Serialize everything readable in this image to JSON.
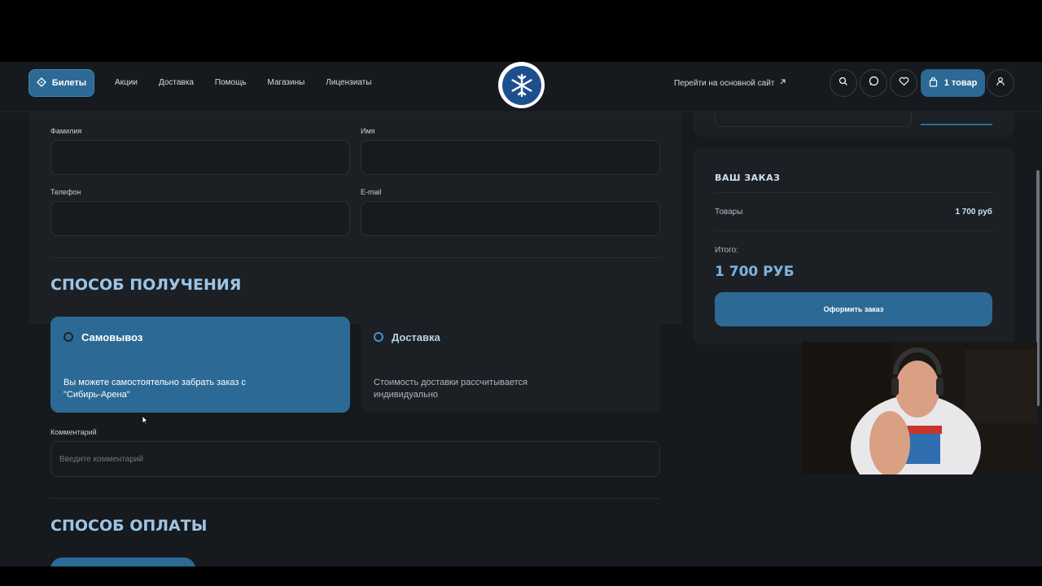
{
  "header": {
    "tickets_label": "Билеты",
    "nav": [
      "Акции",
      "Доставка",
      "Помощь",
      "Магазины",
      "Лицензиаты"
    ],
    "main_site_label": "Перейти на основной сайт",
    "cart_label": "1 товар",
    "logo_icon": "snowflake-logo"
  },
  "form": {
    "surname_label": "Фамилия",
    "name_label": "Имя",
    "phone_label": "Телефон",
    "email_label": "E-mail",
    "delivery_section_title": "СПОСОБ ПОЛУЧЕНИЯ",
    "options": [
      {
        "title": "Самовывоз",
        "desc": "Вы можете самостоятельно забрать заказ с \"Сибирь-Арена\"",
        "selected": true
      },
      {
        "title": "Доставка",
        "desc": "Стоимость доставки рассчитывается индивидуально",
        "selected": false
      }
    ],
    "comment_label": "Комментарий",
    "comment_placeholder": "Введите комментарий",
    "payment_section_title": "СПОСОБ ОПЛАТЫ"
  },
  "order": {
    "title": "ВАШ ЗАКАЗ",
    "goods_label": "Товары",
    "goods_value": "1 700 руб",
    "total_label": "Итого:",
    "total_value": "1 700 РУБ",
    "submit_label": "Оформить заказ"
  },
  "colors": {
    "accent": "#2c6a95",
    "background": "#16191d",
    "panel": "#1c2024",
    "heading": "#9cc4e6"
  }
}
